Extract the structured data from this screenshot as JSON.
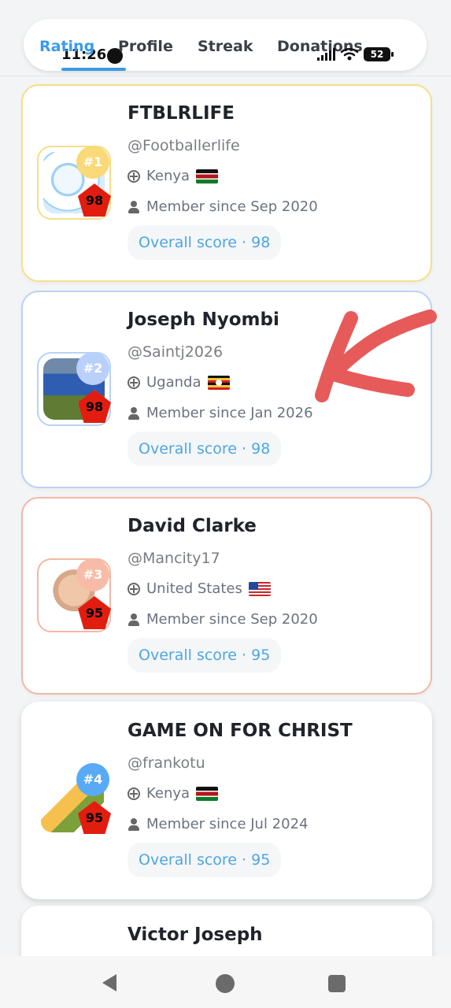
{
  "status": {
    "time": "11:26",
    "battery": "52"
  },
  "tabs": [
    {
      "label": "Rating"
    },
    {
      "label": "Profile"
    },
    {
      "label": "Streak"
    },
    {
      "label": "Donations"
    }
  ],
  "cards": [
    {
      "rank": "#1",
      "name": "FTBLRLIFE",
      "handle": "@Footballerlife",
      "country": "Kenya",
      "member_since": "Member since Sep 2020",
      "overall_score": "Overall score · 98",
      "score": "98"
    },
    {
      "rank": "#2",
      "name": "Joseph Nyombi",
      "handle": "@Saintj2026",
      "country": "Uganda",
      "member_since": "Member since Jan 2026",
      "overall_score": "Overall score · 98",
      "score": "98"
    },
    {
      "rank": "#3",
      "name": "David Clarke",
      "handle": "@Mancity17",
      "country": "United States",
      "member_since": "Member since Sep 2020",
      "overall_score": "Overall score · 95",
      "score": "95"
    },
    {
      "rank": "#4",
      "name": "GAME ON FOR CHRIST",
      "handle": "@frankotu",
      "country": "Kenya",
      "member_since": "Member since Jul 2024",
      "overall_score": "Overall score · 95",
      "score": "95"
    },
    {
      "name": "Victor Joseph"
    }
  ],
  "colors": {
    "accent": "#3b9be8",
    "arrow": "#e75a5a",
    "score_badge": "#e11d10"
  },
  "icons": {
    "globe": "globe-icon",
    "user": "user-icon",
    "back": "back-icon",
    "home": "home-icon",
    "recent": "recent-apps-icon"
  }
}
